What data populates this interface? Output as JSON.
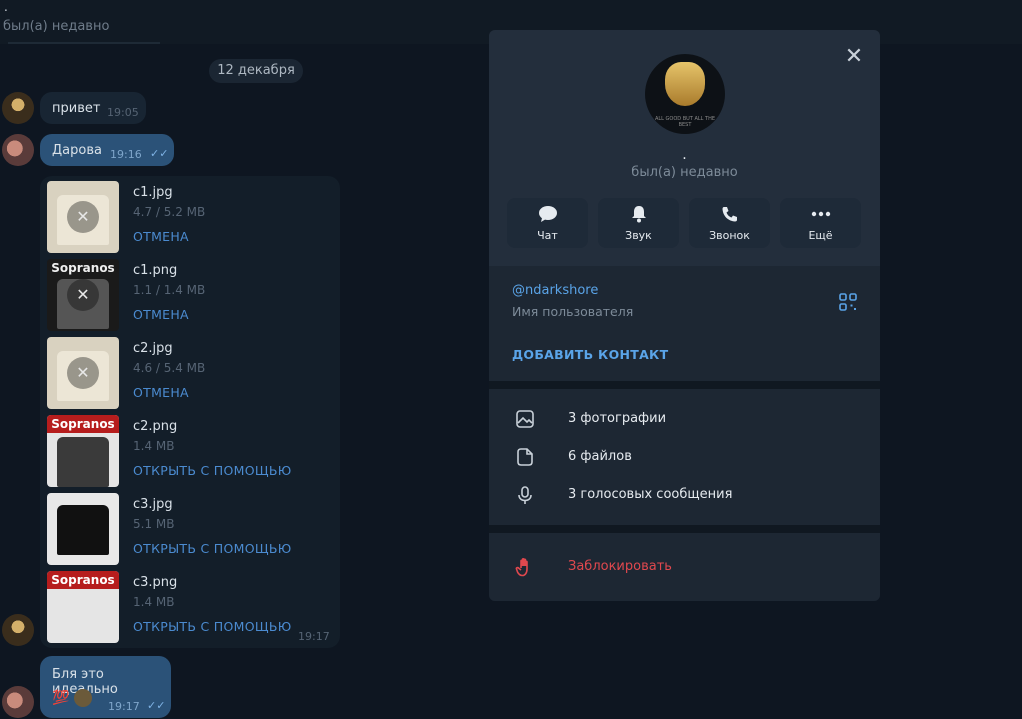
{
  "chat_header": {
    "name": ".",
    "status": "был(а) недавно"
  },
  "date_separator": "12 декабря",
  "messages": [
    {
      "text": "привет",
      "time": "19:05"
    },
    {
      "text": "Дарова",
      "time": "19:16"
    }
  ],
  "files": [
    {
      "name": "c1.jpg",
      "size": "4.7 / 5.2 MB",
      "action": "ОТМЕНА"
    },
    {
      "name": "c1.png",
      "size": "1.1 / 1.4 MB",
      "action": "ОТМЕНА"
    },
    {
      "name": "c2.jpg",
      "size": "4.6 / 5.4 MB",
      "action": "ОТМЕНА"
    },
    {
      "name": "c2.png",
      "size": "1.4 MB",
      "action": "ОТКРЫТЬ С ПОМОЩЬЮ"
    },
    {
      "name": "c3.jpg",
      "size": "5.1 MB",
      "action": "ОТКРЫТЬ С ПОМОЩЬЮ"
    },
    {
      "name": "c3.png",
      "size": "1.4 MB",
      "action": "ОТКРЫТЬ С ПОМОЩЬЮ"
    }
  ],
  "files_time": "19:17",
  "thumb_logo": "Sopranos",
  "last_message": {
    "text": "Бля это идеально",
    "time": "19:17"
  },
  "profile": {
    "name": ".",
    "status": "был(а) недавно",
    "avatar_caption": "ALL GOOD BUT ALL THE BEST",
    "actions": [
      {
        "label": "Чат",
        "icon": "chat-bubble-icon"
      },
      {
        "label": "Звук",
        "icon": "bell-icon"
      },
      {
        "label": "Звонок",
        "icon": "phone-icon"
      },
      {
        "label": "Ещё",
        "icon": "more-dots-icon"
      }
    ],
    "username": "@ndarkshore",
    "username_label": "Имя пользователя",
    "add_contact": "ДОБАВИТЬ КОНТАКТ",
    "media": [
      {
        "label": "3 фотографии",
        "icon": "photo-icon"
      },
      {
        "label": "6 файлов",
        "icon": "file-icon"
      },
      {
        "label": "3 голосовых сообщения",
        "icon": "microphone-icon"
      }
    ],
    "block": "Заблокировать",
    "colors": {
      "accent": "#5aa4e8",
      "danger": "#e0484e",
      "panel": "#17212b"
    }
  }
}
